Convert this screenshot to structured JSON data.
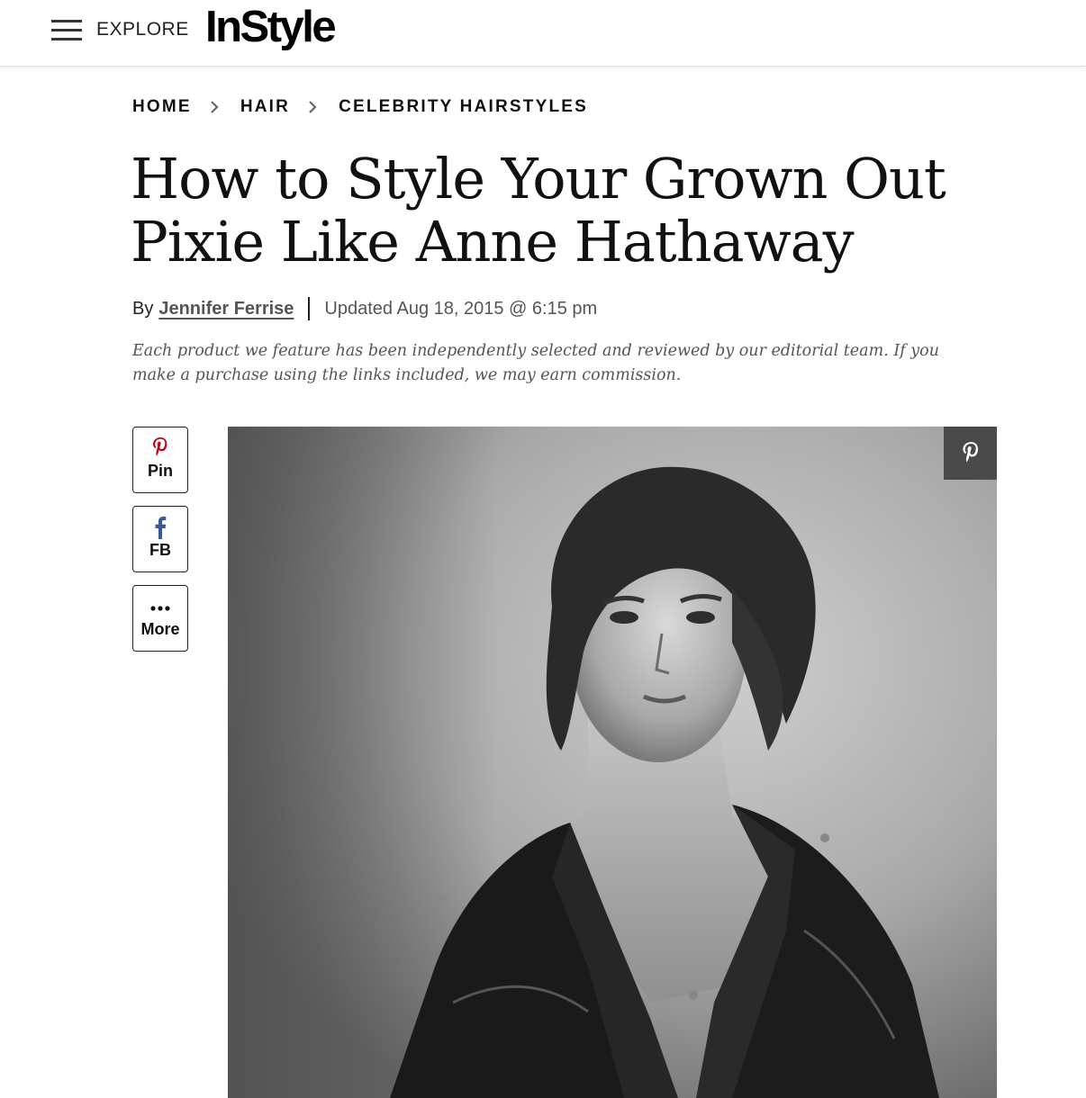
{
  "header": {
    "explore_label": "EXPLORE",
    "logo_text": "InStyle"
  },
  "breadcrumb": {
    "items": [
      "HOME",
      "HAIR",
      "CELEBRITY HAIRSTYLES"
    ]
  },
  "article": {
    "title_line1": "How to Style Your Grown Out",
    "title_line2": "Pixie Like Anne Hathaway",
    "by_prefix": "By",
    "author": "Jennifer Ferrise",
    "updated": "Updated Aug 18, 2015 @ 6:15 pm",
    "disclaimer": "Each product we feature has been independently selected and reviewed by our editorial team. If you make a purchase using the links included, we may earn commission."
  },
  "share": {
    "pin_label": "Pin",
    "fb_label": "FB",
    "more_label": "More"
  },
  "colors": {
    "pinterest_red": "#bd081c",
    "facebook_blue": "#3b5998",
    "pin_overlay_bg": "#4a4a4a"
  },
  "icons": [
    "hamburger-menu-icon",
    "chevron-right-icon",
    "pinterest-icon",
    "facebook-icon",
    "more-dots-icon"
  ]
}
